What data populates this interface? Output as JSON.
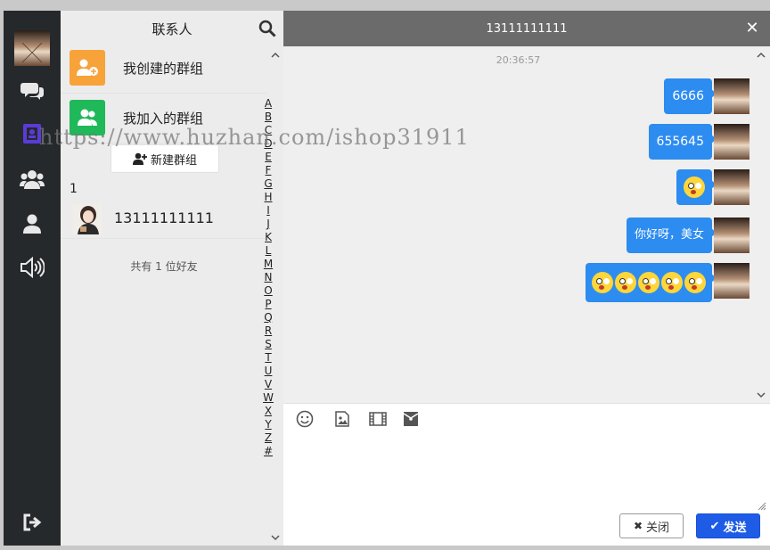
{
  "contacts": {
    "title": "联系人",
    "groups": [
      {
        "label": "我创建的群组",
        "color": "#f7a33a"
      },
      {
        "label": "我加入的群组",
        "color": "#1fb95a"
      }
    ],
    "new_group_label": "新建群组",
    "section_letter": "1",
    "contact_name": "13111111111",
    "friend_count": "共有 1 位好友",
    "alphabet": [
      "A",
      "B",
      "C",
      "D",
      "E",
      "F",
      "G",
      "H",
      "I",
      "J",
      "K",
      "L",
      "M",
      "N",
      "O",
      "P",
      "Q",
      "R",
      "S",
      "T",
      "U",
      "V",
      "W",
      "X",
      "Y",
      "Z",
      "#"
    ]
  },
  "chat": {
    "title": "13111111111",
    "timestamp": "20:36:57",
    "messages": [
      {
        "type": "text",
        "text": "6666"
      },
      {
        "type": "text",
        "text": "655645"
      },
      {
        "type": "emoji",
        "count": 1
      },
      {
        "type": "text",
        "text": "你好呀，美女"
      },
      {
        "type": "emoji",
        "count": 5
      }
    ],
    "close_label": "关闭",
    "send_label": "发送"
  },
  "watermark": "https://www.huzhan.com/ishop31911",
  "icons": {
    "rail": [
      "avatar",
      "chat-icon",
      "contacts-book-icon",
      "group-icon",
      "user-icon",
      "speaker-icon",
      "logout-icon"
    ],
    "toolbar": [
      "emoji-icon",
      "image-icon",
      "video-icon",
      "red-packet-icon"
    ]
  },
  "colors": {
    "rail_bg": "#26292c",
    "accent_blue": "#2d8cf0",
    "send_blue": "#1e5ce6",
    "header_gray": "#6b6b6b",
    "rail_active": "#5b3bd8"
  }
}
